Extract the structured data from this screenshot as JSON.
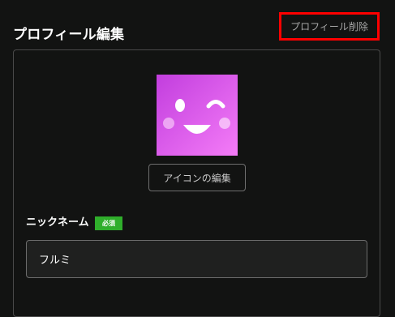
{
  "header": {
    "title": "プロフィール編集",
    "delete_label": "プロフィール削除"
  },
  "profile": {
    "avatar_icon": "winking-smiley-face-icon",
    "avatar_colors": [
      "#c23ede",
      "#f47cf7"
    ],
    "edit_icon_label": "アイコンの編集"
  },
  "nickname": {
    "label": "ニックネーム",
    "required_badge": "必須",
    "value": "フルミ"
  },
  "colors": {
    "background": "#121312",
    "highlight_border": "#ff0000",
    "required_badge": "#2fae2b"
  }
}
